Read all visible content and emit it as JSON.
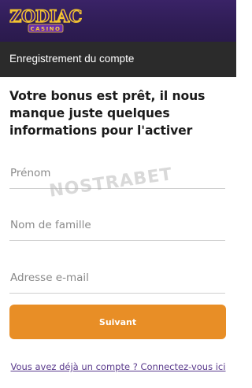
{
  "brand": {
    "logo_text": "ZODIAC",
    "logo_subtext": "CASINO"
  },
  "header": {
    "title": "Enregistrement du compte"
  },
  "form": {
    "intro": "Votre bonus est prêt, il nous manque juste quelques informations pour l'activer",
    "first_name_placeholder": "Prénom",
    "last_name_placeholder": "Nom de famille",
    "email_placeholder": "Adresse e-mail",
    "submit_label": "Suivant"
  },
  "footer": {
    "login_link": "Vous avez déjà un compte ? Connectez-vous ici"
  },
  "watermark": {
    "text": "NOSTRABET"
  },
  "colors": {
    "topbar": "#2f1d55",
    "section_header": "#2b2b2b",
    "primary_button": "#e88e26",
    "link": "#5a3a8c"
  }
}
